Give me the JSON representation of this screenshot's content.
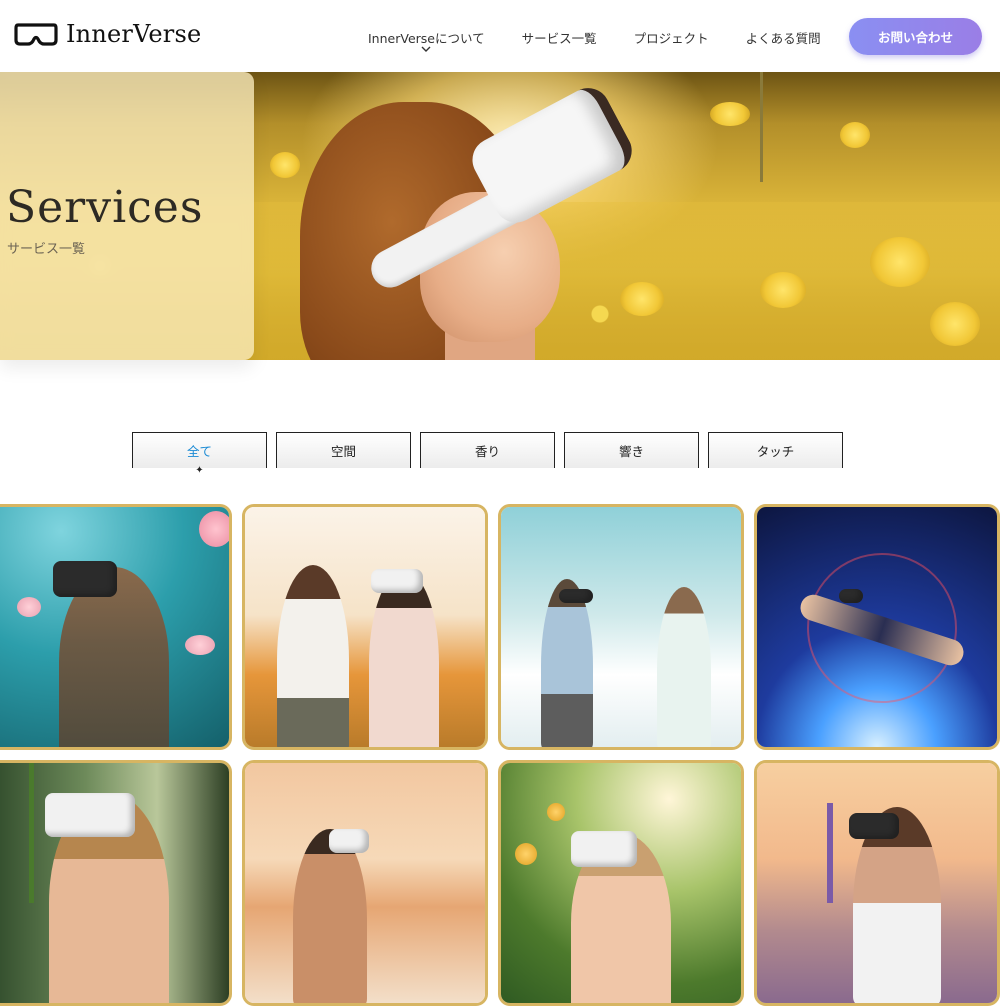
{
  "brand": {
    "name": "InnerVerse"
  },
  "nav": {
    "items": [
      {
        "label": "InnerVerseについて"
      },
      {
        "label": "サービス一覧"
      },
      {
        "label": "プロジェクト"
      },
      {
        "label": "よくある質問"
      }
    ],
    "contact_label": "お問い合わせ"
  },
  "hero": {
    "title": "Services",
    "subtitle": "サービス一覧"
  },
  "filters": {
    "tabs": [
      {
        "label": "全て",
        "active": true
      },
      {
        "label": "空間",
        "active": false
      },
      {
        "label": "香り",
        "active": false
      },
      {
        "label": "響き",
        "active": false
      },
      {
        "label": "タッチ",
        "active": false
      }
    ],
    "active_color": "#1a8ad4"
  },
  "gallery": {
    "cards": [
      {
        "scene": "underwater-jellyfish"
      },
      {
        "scene": "flower-field-couple"
      },
      {
        "scene": "cloud-couple"
      },
      {
        "scene": "space-flying"
      },
      {
        "scene": "forest-herb"
      },
      {
        "scene": "sunset-beach"
      },
      {
        "scene": "citrus-orchard"
      },
      {
        "scene": "lavender-field"
      }
    ],
    "border_color": "#d7b562"
  },
  "colors": {
    "contact_gradient_start": "#8a8ff2",
    "contact_gradient_end": "#9a7ee6"
  }
}
